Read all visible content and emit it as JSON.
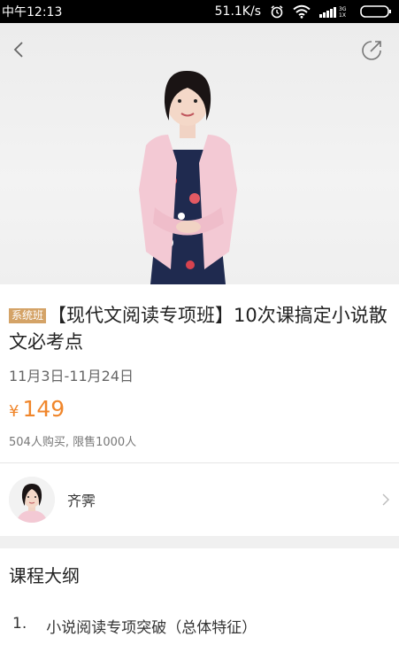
{
  "status_bar": {
    "time": "中午12:13",
    "network_speed": "51.1K/s",
    "icons": [
      "alarm-icon",
      "wifi-icon",
      "signal-icon",
      "battery-icon"
    ],
    "signal_labels": [
      "3G",
      "1X"
    ]
  },
  "header": {
    "back_icon": "back-arrow-icon",
    "share_icon": "share-icon"
  },
  "course": {
    "tag": "系统班",
    "title": "【现代文阅读专项班】10次课搞定小说散文必考点",
    "dates": "11月3日-11月24日",
    "currency": "¥",
    "price": "149",
    "sales_info": "504人购买, 限售1000人"
  },
  "teacher": {
    "name": "齐霁"
  },
  "syllabus": {
    "heading": "课程大纲",
    "items": [
      {
        "number": "1.",
        "title": "小说阅读专项突破（总体特征）"
      }
    ]
  },
  "colors": {
    "accent_price": "#f0862b",
    "tag_bg": "#d4a367",
    "status_bar_bg": "#000000"
  }
}
